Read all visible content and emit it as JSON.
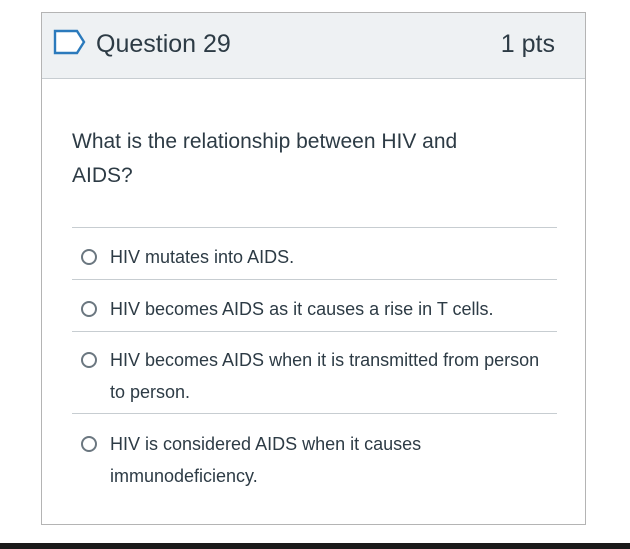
{
  "question": {
    "title": "Question 29",
    "points": "1 pts",
    "text": "What is the relationship between HIV and AIDS?",
    "answers": [
      {
        "label": "HIV mutates into AIDS.",
        "selected": false
      },
      {
        "label": "HIV becomes AIDS as it causes a rise in T cells.",
        "selected": false
      },
      {
        "label": "HIV becomes AIDS when it is transmitted from person to person.",
        "selected": false
      },
      {
        "label": "HIV is considered AIDS when it causes immunodeficiency.",
        "selected": false
      }
    ]
  },
  "icons": {
    "flag": "flag-outline-icon",
    "radio": "radio-unselected-icon"
  },
  "colors": {
    "header_bg": "#eef1f3",
    "border": "#c7cdd1",
    "text": "#2d3b45",
    "flag": "#2b7abc"
  }
}
